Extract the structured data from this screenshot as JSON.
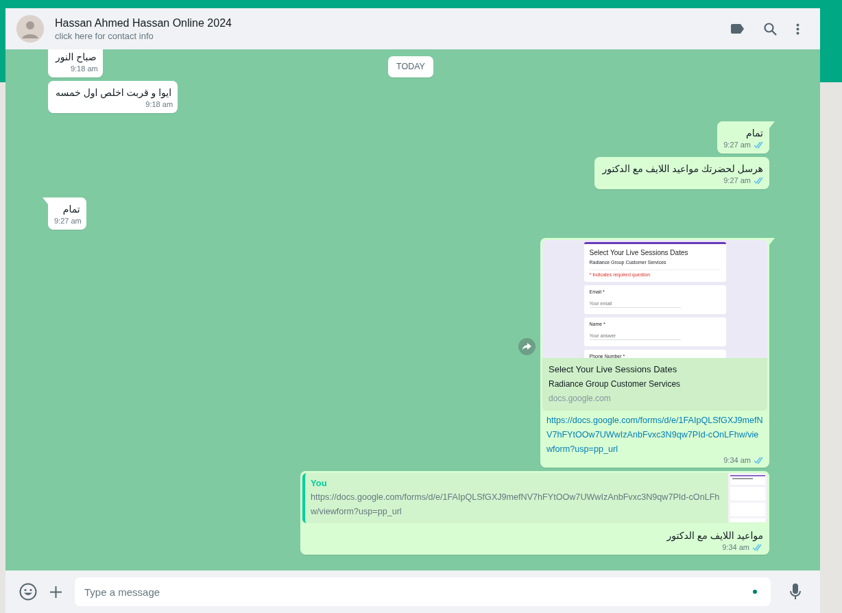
{
  "header": {
    "name": "Hassan Ahmed Hassan Online 2024",
    "subtitle": "click here for contact info"
  },
  "date_chip": "TODAY",
  "messages": [
    {
      "kind": "incoming",
      "tail": false,
      "text": "صباح النور",
      "time": "9:18 am"
    },
    {
      "kind": "incoming",
      "tail": false,
      "text": "ايوا و قربت اخلص اول خمسه",
      "time": "9:18 am"
    },
    {
      "kind": "outgoing",
      "tail": true,
      "text": "تمام",
      "time": "9:27 am",
      "read": true
    },
    {
      "kind": "outgoing",
      "tail": false,
      "text": "هرسل لحضرتك مواعيد اللايف مع الدكتور",
      "time": "9:27 am",
      "read": true
    },
    {
      "kind": "incoming",
      "tail": true,
      "text": "تمام",
      "time": "9:27 am"
    },
    {
      "kind": "link",
      "tail": true,
      "preview": {
        "form": {
          "title": "Select Your Live Sessions Dates",
          "subtitle": "Radiance Group Customer Services",
          "required_note": "* Indicates required question",
          "fields": [
            {
              "label": "Email *",
              "placeholder": "Your email"
            },
            {
              "label": "Name *",
              "placeholder": "Your answer"
            },
            {
              "label": "Phone Number *"
            }
          ]
        },
        "title": "Select Your Live Sessions Dates",
        "description": "Radiance Group Customer Services",
        "domain": "docs.google.com"
      },
      "url": "https://docs.google.com/forms/d/e/1FAIpQLSfGXJ9mefNV7hFYtOOw7UWwIzAnbFvxc3N9qw7PId-cOnLFhw/viewform?usp=pp_url",
      "time": "9:34 am",
      "read": true
    },
    {
      "kind": "reply",
      "tail": false,
      "quote": {
        "author": "You",
        "text": "https://docs.google.com/forms/d/e/1FAIpQLSfGXJ9mefNV7hFYtOOw7UWwIzAnbFvxc3N9qw7PId-cOnLFhw/viewform?usp=pp_url"
      },
      "text": "مواعيد اللايف مع الدكتور",
      "time": "9:34 am",
      "read": true
    }
  ],
  "composer": {
    "placeholder": "Type a message"
  }
}
